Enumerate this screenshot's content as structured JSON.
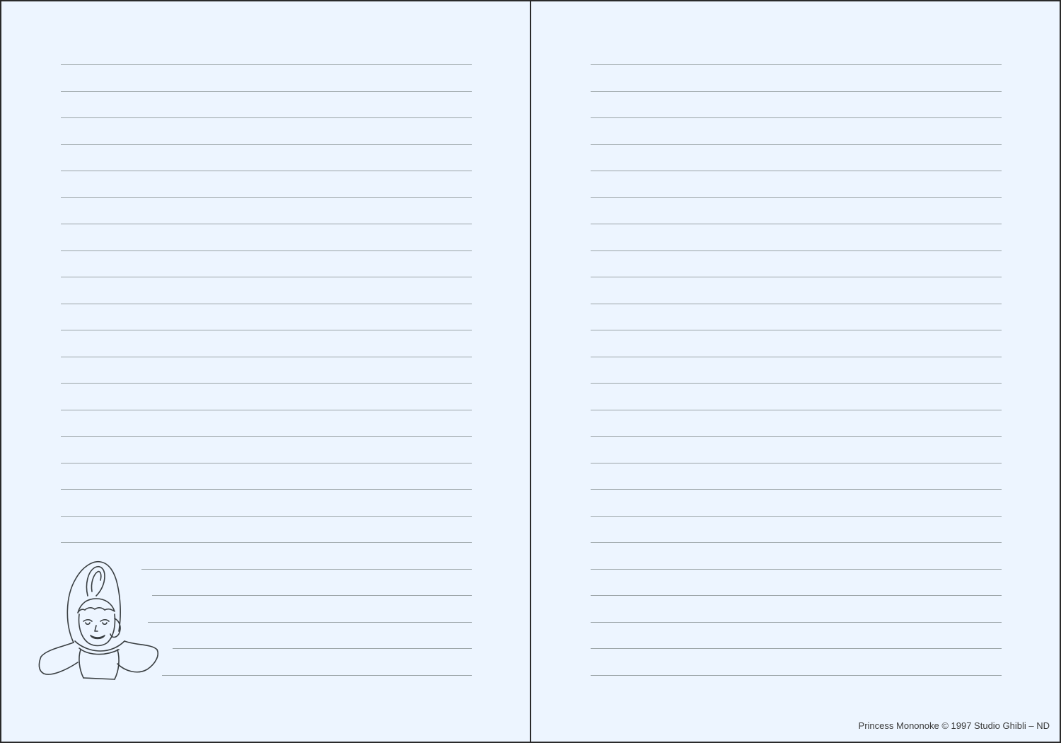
{
  "notebook": {
    "page_color": "#edf5ff",
    "border_color": "#2a2a2a",
    "rule_color": "#9aa3a6",
    "left_page": {
      "ruled_line_count": 24,
      "illustration": {
        "icon": "character-portrait-line-art-icon",
        "description_visible": false
      }
    },
    "right_page": {
      "ruled_line_count": 24,
      "credit": "Princess Mononoke © 1997 Studio Ghibli – ND"
    }
  }
}
